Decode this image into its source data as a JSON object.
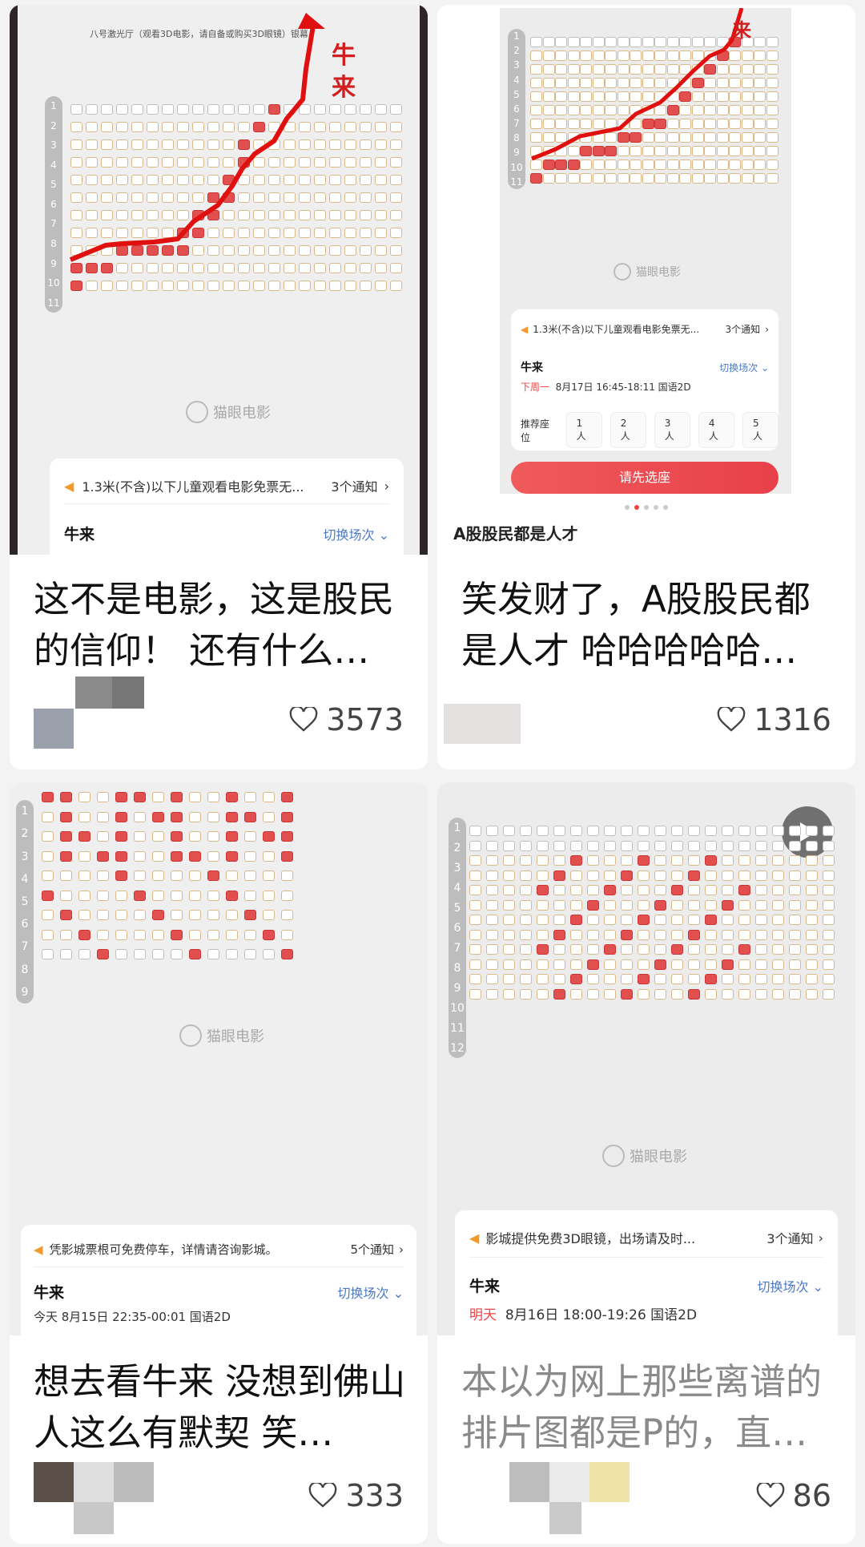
{
  "cards": [
    {
      "caption": "这不是电影，这是股民的信仰！ 还有什么…",
      "likes": "3573",
      "hall": "八号激光厅（观看3D电影，请自备或购买3D眼镜）银幕",
      "red_label": "牛\n来",
      "logo": "猫眼电影",
      "notice": "1.3米(不含)以下儿童观看电影免票无...",
      "notice_count": "3个通知",
      "movie": "牛来",
      "switch": "切换场次"
    },
    {
      "caption": "笑发财了，A股股民都是人才 哈哈哈哈哈…",
      "likes": "1316",
      "red_label": "来",
      "logo": "猫眼电影",
      "notice": "1.3米(不含)以下儿童观看电影免票无...",
      "notice_count": "3个通知",
      "movie": "牛来",
      "switch": "切换场次",
      "date_prefix": "下周一",
      "date": "8月17日  16:45-18:11  国语2D",
      "rec_label": "推荐座位",
      "rec_seats": [
        "1人",
        "2人",
        "3人",
        "4人",
        "5人"
      ],
      "cta": "请先选座",
      "title_overlay": "A股股民都是人才"
    },
    {
      "caption": "想去看牛来 没想到佛山人这么有默契 笑…",
      "likes": "333",
      "logo": "猫眼电影",
      "notice": "凭影城票根可免费停车，详情请咨询影城。",
      "notice_count": "5个通知",
      "movie": "牛来",
      "switch": "切换场次",
      "date": "今天  8月15日  22:35-00:01  国语2D"
    },
    {
      "caption": "本以为网上那些离谱的排片图都是P的，直…",
      "likes": "86",
      "logo": "猫眼电影",
      "notice": "影城提供免费3D眼镜，出场请及时...",
      "notice_count": "3个通知",
      "movie": "牛来",
      "switch": "切换场次",
      "date_prefix": "明天",
      "date": "8月16日  18:00-19:26  国语2D"
    }
  ],
  "colors": {
    "accent_red": "#e44",
    "switch_blue": "#4b79c4",
    "sold_seat": "#e14f4f",
    "text": "#111111"
  },
  "icons": [
    "heart-icon",
    "speaker-icon",
    "chevron-right-icon",
    "chevron-down-icon",
    "play-icon",
    "maoyan-logo-icon"
  ]
}
